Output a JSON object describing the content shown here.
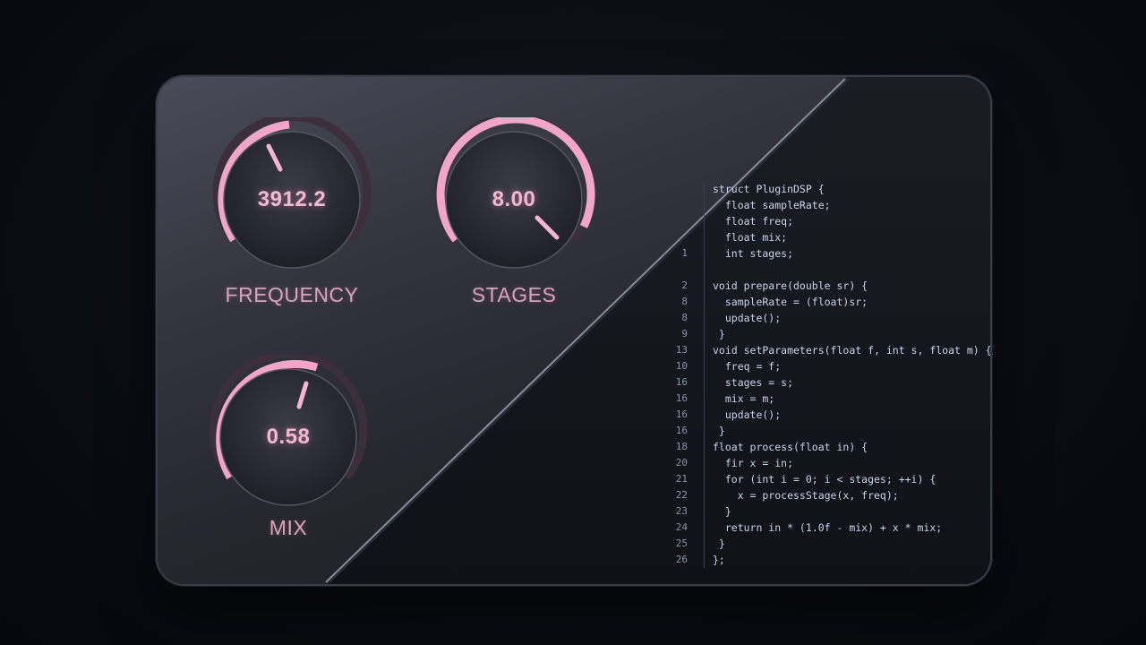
{
  "knobs": [
    {
      "label": "FREQUENCY",
      "value": "3912.2"
    },
    {
      "label": "STAGES",
      "value": "8.00"
    },
    {
      "label": "MIX",
      "value": "0.58"
    }
  ],
  "colors": {
    "accent": "#f0a6c8",
    "label": "#d9a3bc",
    "code_text": "#c9d3ec",
    "keyword": "#c8a0ff",
    "line_number": "#8d93a6"
  },
  "code": [
    {
      "num": "",
      "text": "struct PluginDSP {"
    },
    {
      "num": "",
      "text": "  float sampleRate;"
    },
    {
      "num": "",
      "text": "  float freq;"
    },
    {
      "num": "",
      "text": "  float mix;"
    },
    {
      "num": "1",
      "text": "  int stages;"
    },
    {
      "num": "",
      "text": ""
    },
    {
      "num": "2",
      "text": "void prepare(double sr) {"
    },
    {
      "num": "8",
      "text": "  sampleRate = (float)sr;"
    },
    {
      "num": "8",
      "text": "  update();"
    },
    {
      "num": "9",
      "text": " }"
    },
    {
      "num": "13",
      "text": "void setParameters(float f, int s, float m) {"
    },
    {
      "num": "10",
      "text": "  freq = f;"
    },
    {
      "num": "16",
      "text": "  stages = s;"
    },
    {
      "num": "16",
      "text": "  mix = m;"
    },
    {
      "num": "16",
      "text": "  update();"
    },
    {
      "num": "16",
      "text": " }"
    },
    {
      "num": "18",
      "text": "float process(float in) {"
    },
    {
      "num": "20",
      "text": "  fir x = in;"
    },
    {
      "num": "21",
      "text": "  for (int i = 0; i < stages; ++i) {"
    },
    {
      "num": "22",
      "text": "    x = processStage(x, freq);"
    },
    {
      "num": "23",
      "text": "  }"
    },
    {
      "num": "24",
      "text": "  return in * (1.0f - mix) + x * mix;"
    },
    {
      "num": "25",
      "text": " }"
    },
    {
      "num": "26",
      "text": "};"
    }
  ]
}
